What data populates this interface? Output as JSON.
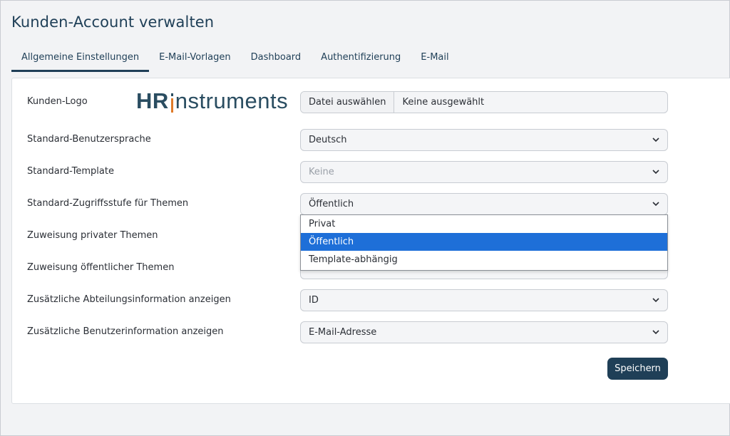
{
  "page": {
    "title": "Kunden-Account verwalten"
  },
  "tabs": [
    {
      "label": "Allgemeine Einstellungen",
      "active": true
    },
    {
      "label": "E-Mail-Vorlagen",
      "active": false
    },
    {
      "label": "Dashboard",
      "active": false
    },
    {
      "label": "Authentifizierung",
      "active": false
    },
    {
      "label": "E-Mail",
      "active": false
    }
  ],
  "form": {
    "logo": {
      "label": "Kunden-Logo",
      "logo_text_hr": "HR",
      "logo_text_rest": "nstruments",
      "file_button": "Datei auswählen",
      "file_status": "Keine ausgewählt"
    },
    "language": {
      "label": "Standard-Benutzersprache",
      "value": "Deutsch"
    },
    "template": {
      "label": "Standard-Template",
      "placeholder": "Keine"
    },
    "access_level": {
      "label": "Standard-Zugriffsstufe für Themen",
      "value": "Öffentlich",
      "options": [
        "Privat",
        "Öffentlich",
        "Template-abhängig"
      ],
      "selected_index": 1
    },
    "private_topics": {
      "label": "Zuweisung privater Themen"
    },
    "public_topics": {
      "label": "Zuweisung öffentlicher Themen"
    },
    "department_info": {
      "label": "Zusätzliche Abteilungsinformation anzeigen",
      "value": "ID"
    },
    "user_info": {
      "label": "Zusätzliche Benutzerinformation anzeigen",
      "value": "E-Mail-Adresse"
    },
    "save_label": "Speichern"
  },
  "colors": {
    "primary": "#1f3f57",
    "selected_option": "#1e6fd8",
    "logo_accent": "#e07b2a"
  }
}
